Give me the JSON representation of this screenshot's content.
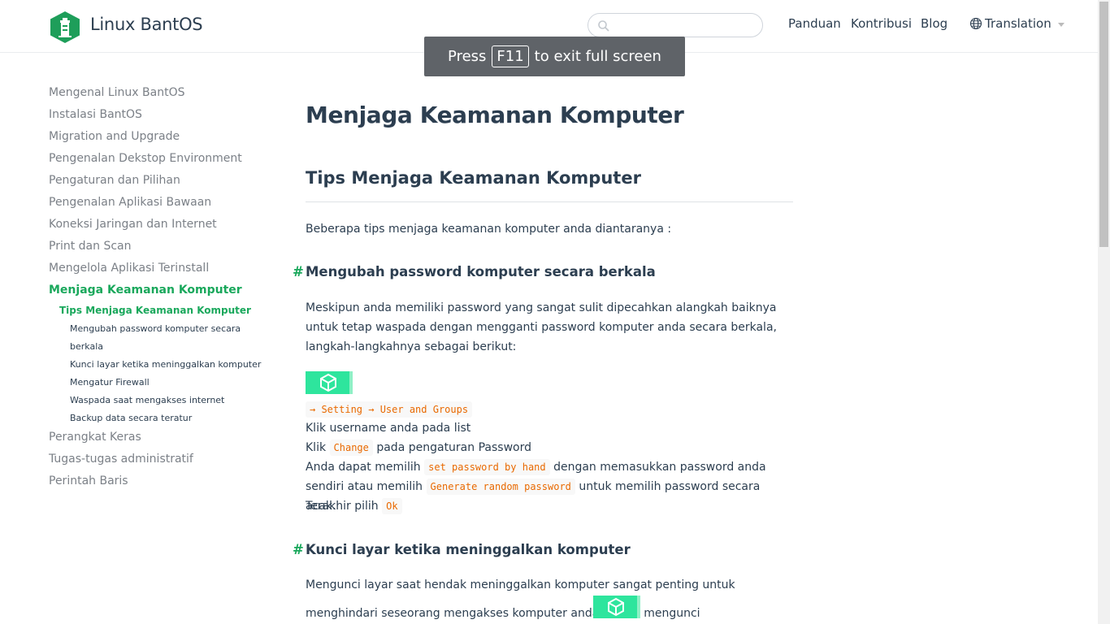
{
  "header": {
    "site_name": "Linux BantOS",
    "search": {
      "placeholder": "",
      "value": ""
    },
    "nav": {
      "panduan": "Panduan",
      "kontribusi": "Kontribusi",
      "blog": "Blog",
      "translation": "Translation"
    }
  },
  "toast": {
    "press": "Press",
    "key": "F11",
    "rest": "to exit full screen"
  },
  "sidebar": {
    "items": [
      "Mengenal Linux BantOS",
      "Instalasi BantOS",
      "Migration and Upgrade",
      "Pengenalan Dekstop Environment",
      "Pengaturan dan Pilihan",
      "Pengenalan Aplikasi Bawaan",
      "Koneksi Jaringan dan Internet",
      "Print dan Scan",
      "Mengelola Aplikasi Terinstall",
      "Menjaga Keamanan Komputer"
    ],
    "sub": "Tips Menjaga Keamanan Komputer",
    "subsub": [
      "Mengubah password komputer secara berkala",
      "Kunci layar ketika meninggalkan komputer",
      "Mengatur Firewall",
      "Waspada saat mengakses internet",
      "Backup data secara teratur"
    ],
    "after": [
      "Perangkat Keras",
      "Tugas-tugas administratif",
      "Perintah Baris"
    ]
  },
  "content": {
    "h1": "Menjaga Keamanan Komputer",
    "h2": "Tips Menjaga Keamanan Komputer",
    "intro": "Beberapa tips menjaga keamanan komputer anda diantaranya :",
    "s1": {
      "anchor": "#",
      "title": "Mengubah password komputer secara berkala",
      "para": "Meskipun anda memiliki password yang sangat sulit dipecahkan alangkah baiknya untuk tetap waspada dengan mengganti password komputer anda secara berkala, langkah-langkahnya sebagai berikut:",
      "path_code": "→ Setting → User and Groups",
      "step1": "Klik username anda pada list",
      "step2_pre": "Klik",
      "step2_code": "Change",
      "step2_post": "pada pengaturan Password",
      "step3_pre": "Anda dapat memilih",
      "step3_code1": "set password by hand",
      "step3_mid": "dengan memasukkan password anda sendiri atau memilih",
      "step3_code2": "Generate random password",
      "step3_post": "untuk memilih password secara acak.",
      "step4_pre": "Terakhir pilih",
      "step4_code": "Ok"
    },
    "s2": {
      "anchor": "#",
      "title": "Kunci layar ketika meninggalkan komputer",
      "para": "Mengunci layar saat hendak meninggalkan komputer sangat penting untuk menghindari seseorang mengakses komputer anda. Untuk mengunci"
    }
  },
  "colors": {
    "accent": "#1aa85c",
    "badge": "#2ee59d",
    "code": "#e96900",
    "text": "#2c3e50"
  }
}
